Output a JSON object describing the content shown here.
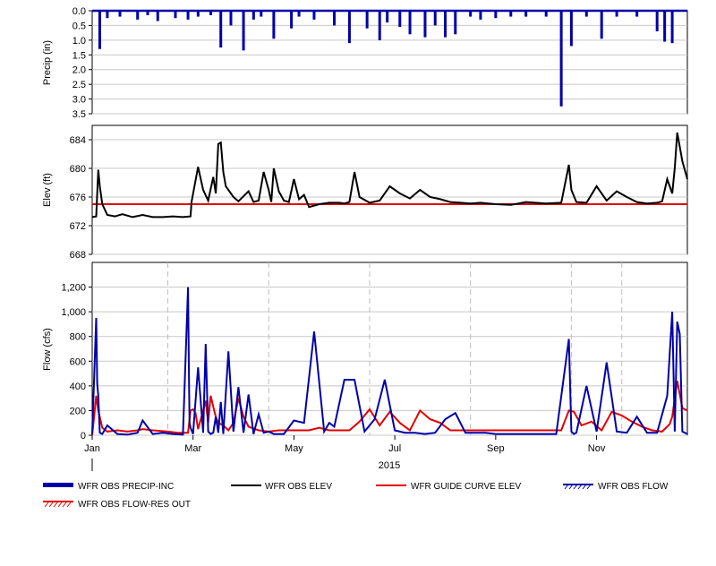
{
  "chart_data": [
    {
      "type": "bar",
      "panel": "precip",
      "ylabel": "Precip (in)",
      "yticks": [
        "0.0",
        "0.5",
        "1.0",
        "1.5",
        "2.0",
        "2.5",
        "3.0",
        "3.5"
      ],
      "ylim": [
        3.5,
        0
      ],
      "grid": true,
      "color": "#0000a8",
      "x_months": [
        0.15,
        0.3,
        0.55,
        0.9,
        1.1,
        1.3,
        1.65,
        1.9,
        2.1,
        2.35,
        2.55,
        2.75,
        3.0,
        3.2,
        3.35,
        3.6,
        3.95,
        4.1,
        4.4,
        4.8,
        5.1,
        5.45,
        5.7,
        5.85,
        6.1,
        6.3,
        6.6,
        6.8,
        7.0,
        7.2,
        7.5,
        7.7,
        8.0,
        8.3,
        8.6,
        9.0,
        9.3,
        9.5,
        9.8,
        10.1,
        10.4,
        10.8,
        11.2,
        11.35,
        11.5
      ],
      "values": [
        1.3,
        0.25,
        0.2,
        0.3,
        0.15,
        0.35,
        0.25,
        0.3,
        0.2,
        0.15,
        1.25,
        0.5,
        1.35,
        0.3,
        0.2,
        0.95,
        0.6,
        0.2,
        0.3,
        0.5,
        1.1,
        0.6,
        1.0,
        0.4,
        0.55,
        0.8,
        0.9,
        0.5,
        0.9,
        0.8,
        0.2,
        0.3,
        0.25,
        0.2,
        0.2,
        0.2,
        3.25,
        1.2,
        0.2,
        0.95,
        0.2,
        0.2,
        0.7,
        1.05,
        1.1
      ]
    },
    {
      "type": "line",
      "panel": "elev",
      "ylabel": "Elev (ft)",
      "yticks": [
        "668",
        "672",
        "676",
        "680",
        "684"
      ],
      "ylim": [
        668,
        686
      ],
      "grid": true,
      "series": [
        {
          "name": "WFR OBS ELEV",
          "color": "#000000",
          "x_months": [
            0,
            0.08,
            0.12,
            0.15,
            0.2,
            0.3,
            0.45,
            0.6,
            0.8,
            1.0,
            1.2,
            1.4,
            1.6,
            1.8,
            1.95,
            1.97,
            2.1,
            2.2,
            2.3,
            2.4,
            2.45,
            2.5,
            2.55,
            2.6,
            2.65,
            2.8,
            2.9,
            3.1,
            3.2,
            3.3,
            3.4,
            3.5,
            3.55,
            3.6,
            3.7,
            3.8,
            3.9,
            4.0,
            4.1,
            4.2,
            4.3,
            4.5,
            4.7,
            4.9,
            5.0,
            5.1,
            5.2,
            5.3,
            5.5,
            5.7,
            5.9,
            6.1,
            6.3,
            6.5,
            6.7,
            6.9,
            7.1,
            7.3,
            7.5,
            7.7,
            8.0,
            8.3,
            8.6,
            9.0,
            9.3,
            9.45,
            9.5,
            9.6,
            9.8,
            10.0,
            10.2,
            10.4,
            10.6,
            10.8,
            11.0,
            11.2,
            11.3,
            11.4,
            11.5,
            11.55,
            11.6,
            11.7,
            11.8
          ],
          "values": [
            673.2,
            673.3,
            679.8,
            677.5,
            675,
            673.5,
            673.3,
            673.6,
            673.2,
            673.5,
            673.2,
            673.2,
            673.3,
            673.2,
            673.3,
            675.3,
            680.2,
            677,
            675.5,
            678.8,
            676.5,
            683.4,
            683.6,
            679.5,
            677.5,
            676,
            675.4,
            676.8,
            675.3,
            675.5,
            679.5,
            677,
            675.3,
            680,
            676.8,
            675.5,
            675.3,
            678.5,
            675.7,
            676.3,
            674.6,
            675,
            675.2,
            675.2,
            675.1,
            675.3,
            679.5,
            676,
            675.2,
            675.5,
            677.5,
            676.5,
            675.8,
            677,
            676,
            675.7,
            675.3,
            675.2,
            675.1,
            675.2,
            675,
            674.9,
            675.3,
            675.1,
            675.2,
            680.5,
            677,
            675.3,
            675.2,
            677.5,
            675.5,
            676.8,
            676,
            675.3,
            675.1,
            675.2,
            675.4,
            678.5,
            676.5,
            680,
            685,
            681,
            678.5
          ]
        },
        {
          "name": "WFR GUIDE CURVE ELEV",
          "color": "#e00000",
          "x_months": [
            0,
            11.8
          ],
          "values": [
            675,
            675
          ]
        }
      ]
    },
    {
      "type": "line",
      "panel": "flow",
      "ylabel": "Flow (cfs)",
      "yticks": [
        "0",
        "200",
        "400",
        "600",
        "800",
        "1,000",
        "1,200"
      ],
      "ylim": [
        0,
        1400
      ],
      "grid": true,
      "xticks": [
        "Jan",
        "Mar",
        "May",
        "Jul",
        "Sep",
        "Nov"
      ],
      "xlabel": "2015",
      "series": [
        {
          "name": "WFR OBS FLOW",
          "color": "#0000a8",
          "x_months": [
            0,
            0.08,
            0.1,
            0.12,
            0.15,
            0.2,
            0.3,
            0.5,
            0.7,
            0.9,
            1.0,
            1.2,
            1.4,
            1.6,
            1.8,
            1.9,
            1.92,
            1.93,
            1.95,
            2.0,
            2.1,
            2.2,
            2.25,
            2.3,
            2.35,
            2.4,
            2.45,
            2.5,
            2.55,
            2.6,
            2.7,
            2.8,
            2.9,
            3.0,
            3.1,
            3.2,
            3.3,
            3.4,
            3.5,
            3.6,
            3.8,
            4.0,
            4.2,
            4.4,
            4.6,
            4.7,
            4.8,
            5.0,
            5.2,
            5.4,
            5.6,
            5.8,
            6.0,
            6.2,
            6.4,
            6.6,
            6.8,
            7.0,
            7.2,
            7.4,
            7.6,
            7.8,
            8.0,
            8.3,
            8.6,
            8.9,
            9.2,
            9.45,
            9.5,
            9.55,
            9.6,
            9.8,
            10.0,
            10.2,
            10.4,
            10.6,
            10.8,
            11.0,
            11.2,
            11.4,
            11.5,
            11.55,
            11.6,
            11.65,
            11.7,
            11.8
          ],
          "values": [
            10,
            950,
            420,
            320,
            20,
            10,
            80,
            10,
            5,
            20,
            120,
            10,
            20,
            10,
            5,
            1200,
            430,
            100,
            60,
            10,
            550,
            20,
            740,
            30,
            10,
            20,
            150,
            20,
            270,
            10,
            680,
            30,
            390,
            20,
            330,
            10,
            170,
            20,
            30,
            10,
            10,
            120,
            100,
            840,
            30,
            100,
            70,
            450,
            450,
            30,
            130,
            450,
            40,
            20,
            20,
            10,
            20,
            130,
            180,
            20,
            20,
            20,
            10,
            10,
            10,
            10,
            10,
            780,
            30,
            10,
            20,
            400,
            30,
            590,
            30,
            20,
            150,
            20,
            20,
            320,
            1000,
            30,
            920,
            820,
            30,
            10
          ]
        },
        {
          "name": "WFR OBS FLOW-RES OUT",
          "color": "#e00000",
          "x_months": [
            0,
            0.08,
            0.12,
            0.2,
            0.3,
            0.5,
            0.7,
            0.9,
            1.0,
            1.2,
            1.5,
            1.7,
            1.9,
            1.95,
            2.0,
            2.05,
            2.1,
            2.2,
            2.25,
            2.3,
            2.35,
            2.4,
            2.45,
            2.5,
            2.6,
            2.7,
            2.8,
            2.9,
            3.0,
            3.1,
            3.3,
            3.5,
            3.7,
            3.9,
            4.1,
            4.3,
            4.5,
            4.7,
            4.9,
            5.1,
            5.3,
            5.5,
            5.7,
            5.9,
            6.1,
            6.3,
            6.5,
            6.7,
            6.9,
            7.1,
            7.3,
            7.5,
            7.7,
            7.9,
            8.1,
            8.3,
            8.5,
            8.7,
            8.9,
            9.1,
            9.3,
            9.45,
            9.55,
            9.7,
            9.9,
            10.1,
            10.3,
            10.5,
            10.7,
            10.9,
            11.1,
            11.3,
            11.45,
            11.5,
            11.6,
            11.7,
            11.8
          ],
          "values": [
            0,
            320,
            200,
            60,
            30,
            40,
            30,
            40,
            50,
            40,
            30,
            20,
            20,
            200,
            210,
            180,
            50,
            200,
            280,
            100,
            320,
            230,
            150,
            100,
            80,
            40,
            100,
            300,
            150,
            70,
            40,
            30,
            40,
            40,
            40,
            40,
            60,
            40,
            40,
            40,
            110,
            210,
            80,
            190,
            100,
            40,
            200,
            130,
            100,
            40,
            40,
            40,
            40,
            40,
            40,
            40,
            40,
            40,
            40,
            40,
            40,
            200,
            190,
            80,
            110,
            40,
            190,
            160,
            110,
            70,
            40,
            30,
            90,
            150,
            440,
            220,
            200
          ]
        }
      ]
    }
  ],
  "legend": [
    {
      "label": "WFR OBS PRECIP-INC",
      "color": "#0000a8",
      "style": "thick-bar"
    },
    {
      "label": "WFR OBS ELEV",
      "color": "#000000",
      "style": "line"
    },
    {
      "label": "WFR GUIDE CURVE ELEV",
      "color": "#e00000",
      "style": "line"
    },
    {
      "label": "WFR OBS FLOW",
      "color": "#0000a8",
      "style": "hatched"
    },
    {
      "label": "WFR OBS FLOW-RES OUT",
      "color": "#e00000",
      "style": "hatched"
    }
  ]
}
